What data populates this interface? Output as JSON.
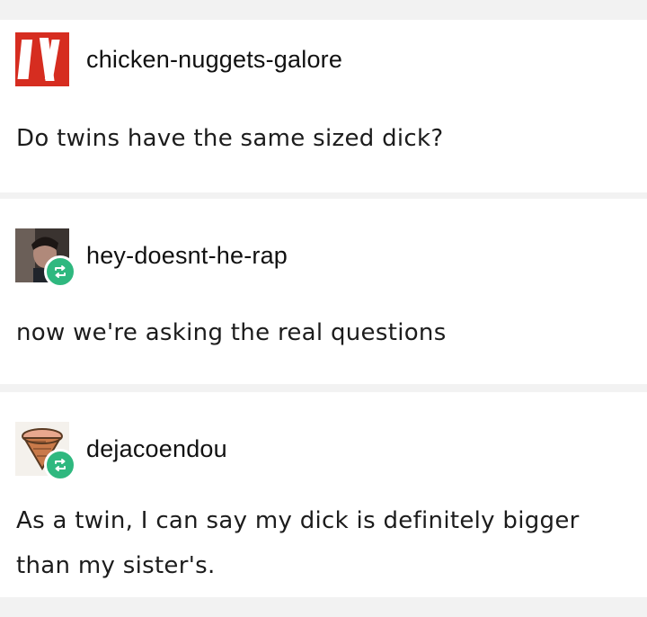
{
  "posts": [
    {
      "username": "chicken-nuggets-galore",
      "text": "Do twins have the same sized dick?",
      "avatar_icon": "red-bars-avatar-icon",
      "reblog": false
    },
    {
      "username": "hey-doesnt-he-rap",
      "text": "now we're asking the real questions",
      "avatar_icon": "person-photo-avatar-icon",
      "reblog": true
    },
    {
      "username": "dejacoendou",
      "text": "As a twin, I can say my dick is definitely bigger than my sister's.",
      "avatar_icon": "ice-cream-cone-avatar-icon",
      "reblog": true
    }
  ],
  "colors": {
    "background": "#f2f2f2",
    "card": "#ffffff",
    "reblog_badge": "#2fb87f",
    "avatar_red": "#d62d20"
  }
}
